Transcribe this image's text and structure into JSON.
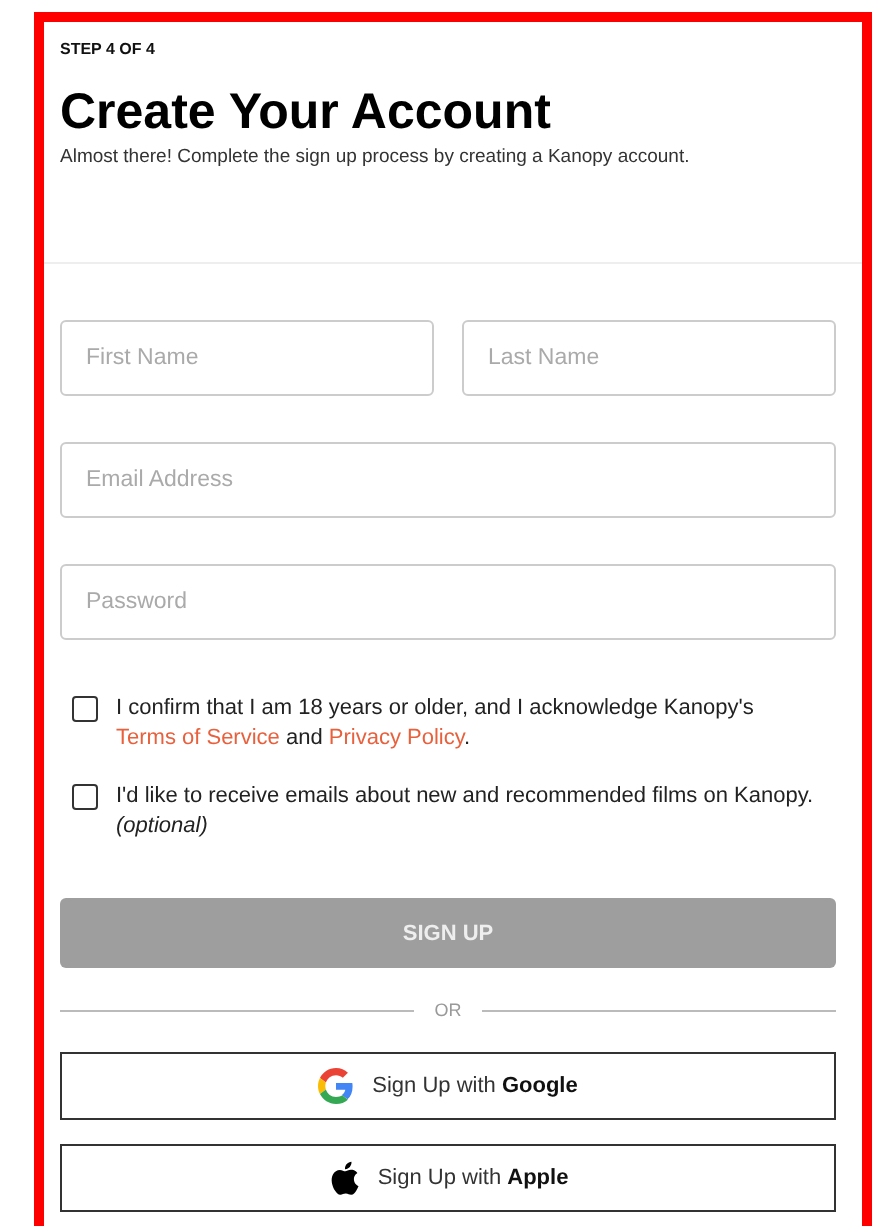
{
  "step": "STEP 4 OF 4",
  "title": "Create Your Account",
  "subtitle": "Almost there! Complete the sign up process by creating a Kanopy account.",
  "field_rows": [
    [
      {
        "placeholder": "First Name"
      },
      {
        "placeholder": "Last Name"
      }
    ],
    [
      {
        "placeholder": "Email Address"
      }
    ],
    [
      {
        "placeholder": "Password"
      }
    ]
  ],
  "checkboxes": [
    {
      "checked": false,
      "parts": [
        {
          "kind": "text",
          "text": "I confirm that I am 18 years or older, and I acknowledge Kanopy's "
        },
        {
          "kind": "link",
          "text": "Terms of Service"
        },
        {
          "kind": "text",
          "text": " and "
        },
        {
          "kind": "link",
          "text": "Privacy Policy"
        },
        {
          "kind": "text",
          "text": "."
        }
      ]
    },
    {
      "checked": false,
      "parts": [
        {
          "kind": "text",
          "text": "I'd like to receive emails about new and recommended films on Kanopy. *(optional)*"
        }
      ]
    }
  ],
  "submit": {
    "label": "SIGN UP",
    "disabled": true
  },
  "divider": "OR",
  "social_buttons": [
    {
      "kind": "google",
      "label": "Sign Up with **Google**"
    },
    {
      "kind": "apple",
      "label": "Sign Up with **Apple**"
    }
  ]
}
